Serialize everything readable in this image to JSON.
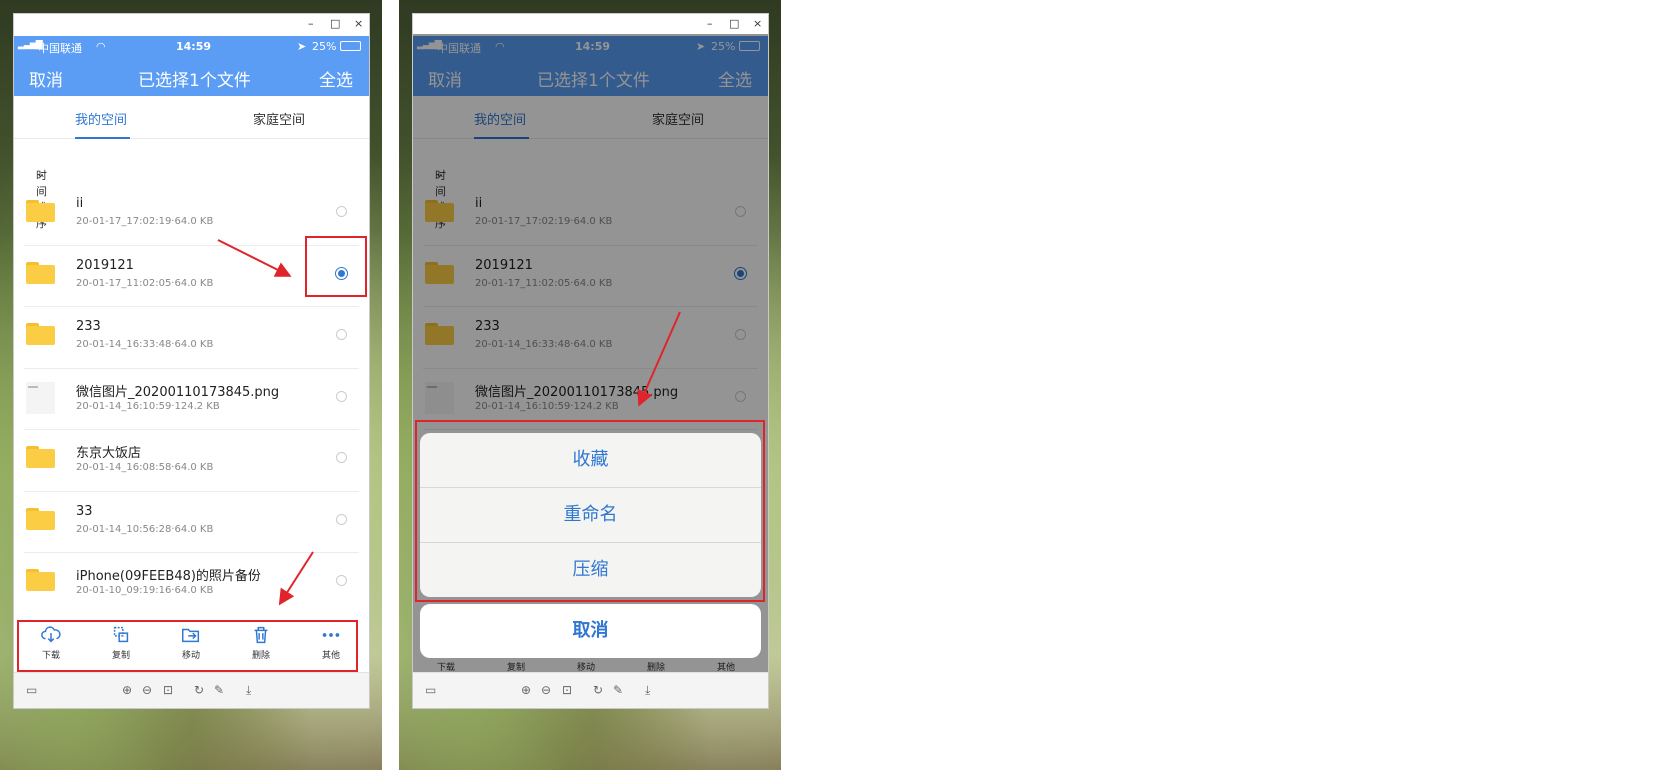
{
  "left_screen": {
    "status": {
      "carrier": "中国联通",
      "time": "14:59",
      "battery": "25%"
    },
    "nav": {
      "cancel": "取消",
      "title": "已选择1个文件",
      "select_all": "全选"
    },
    "tabs": [
      "我的空间",
      "家庭空间"
    ],
    "sort_label": "时间排序",
    "files": [
      {
        "name": "ii",
        "meta": "20-01-17_17:02:19·64.0 KB",
        "type": "folder",
        "selected": false
      },
      {
        "name": "2019121",
        "meta": "20-01-17_11:02:05·64.0 KB",
        "type": "folder",
        "selected": true
      },
      {
        "name": "233",
        "meta": "20-01-14_16:33:48·64.0 KB",
        "type": "folder",
        "selected": false
      },
      {
        "name": "微信图片_20200110173845.png",
        "meta": "20-01-14_16:10:59·124.2 KB",
        "type": "image",
        "selected": false
      },
      {
        "name": "东京大饭店",
        "meta": "20-01-14_16:08:58·64.0 KB",
        "type": "folder",
        "selected": false
      },
      {
        "name": "33",
        "meta": "20-01-14_10:56:28·64.0 KB",
        "type": "folder",
        "selected": false
      },
      {
        "name": "iPhone(09FEEB48)的照片备份",
        "meta": "20-01-10_09:19:16·64.0 KB",
        "type": "folder",
        "selected": false
      }
    ],
    "toolbar": [
      {
        "label": "下载",
        "icon": "cloud-download-icon"
      },
      {
        "label": "复制",
        "icon": "copy-icon"
      },
      {
        "label": "移动",
        "icon": "move-icon"
      },
      {
        "label": "删除",
        "icon": "trash-icon"
      },
      {
        "label": "其他",
        "icon": "more-icon"
      }
    ]
  },
  "right_screen": {
    "status": {
      "carrier": "中国联通",
      "time": "14:59",
      "battery": "25%"
    },
    "nav": {
      "cancel": "取消",
      "title": "已选择1个文件",
      "select_all": "全选"
    },
    "tabs": [
      "我的空间",
      "家庭空间"
    ],
    "sort_label": "时间排序",
    "files": [
      {
        "name": "ii",
        "meta": "20-01-17_17:02:19·64.0 KB",
        "type": "folder",
        "selected": false
      },
      {
        "name": "2019121",
        "meta": "20-01-17_11:02:05·64.0 KB",
        "type": "folder",
        "selected": true
      },
      {
        "name": "233",
        "meta": "20-01-14_16:33:48·64.0 KB",
        "type": "folder",
        "selected": false
      },
      {
        "name": "微信图片_20200110173845.png",
        "meta": "20-01-14_16:10:59·124.2 KB",
        "type": "image",
        "selected": false
      }
    ],
    "action_sheet": {
      "items": [
        "收藏",
        "重命名",
        "压缩"
      ],
      "cancel": "取消"
    },
    "toolbar_labels": [
      "下载",
      "复制",
      "移动",
      "删除",
      "其他"
    ]
  },
  "window_controls": {
    "minimize": "–",
    "maximize": "□",
    "close": "×"
  },
  "colors": {
    "accent": "#5b9df4",
    "link": "#2f77d1",
    "annotation": "#e0242b",
    "folder": "#fbcd45"
  }
}
